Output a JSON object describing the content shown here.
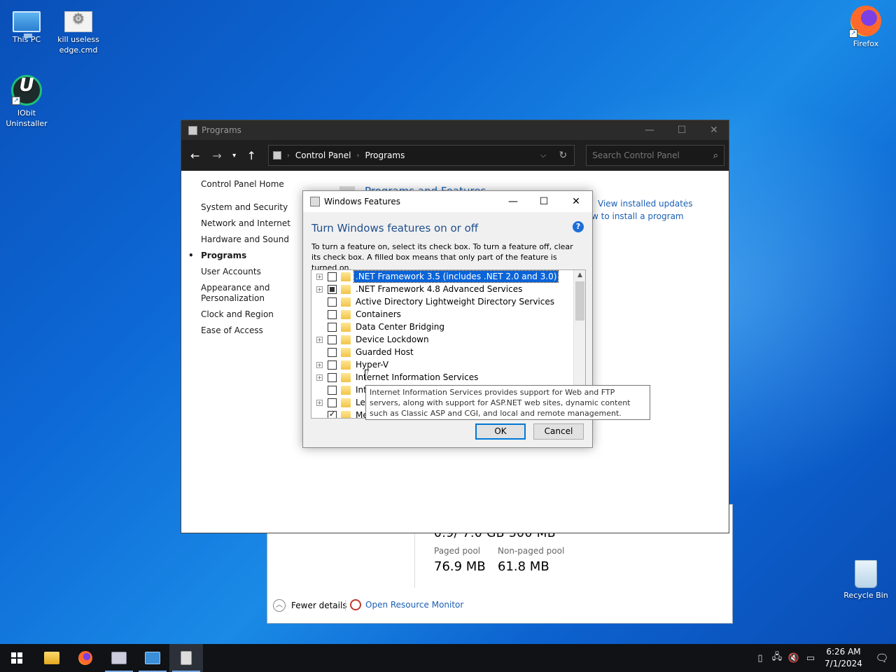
{
  "desktop": {
    "icons": [
      {
        "label": "This PC"
      },
      {
        "label": "kill useless edge.cmd"
      },
      {
        "label": "IObit Uninstaller"
      },
      {
        "label": "Firefox"
      },
      {
        "label": "Recycle Bin"
      }
    ]
  },
  "task_manager": {
    "cut_text": "0.9/ 7.0 GB    300 MB",
    "paged_pool_label": "Paged pool",
    "paged_pool_value": "76.9 MB",
    "nonpaged_pool_label": "Non-paged pool",
    "nonpaged_pool_value": "61.8 MB",
    "fewer_details": "Fewer details",
    "open_resource_monitor": "Open Resource Monitor"
  },
  "control_panel": {
    "title": "Programs",
    "breadcrumb": [
      "Control Panel",
      "Programs"
    ],
    "search_placeholder": "Search Control Panel",
    "sidebar": {
      "home": "Control Panel Home",
      "items": [
        "System and Security",
        "Network and Internet",
        "Hardware and Sound",
        "Programs",
        "User Accounts",
        "Appearance and Personalization",
        "Clock and Region",
        "Ease of Access"
      ],
      "active_index": 3
    },
    "heading": "Programs and Features",
    "link_view_updates": "View installed updates",
    "link_how_install": "w to install a program"
  },
  "windows_features": {
    "title": "Windows Features",
    "heading": "Turn Windows features on or off",
    "help_icon": "?",
    "description": "To turn a feature on, select its check box. To turn a feature off, clear its check box. A filled box means that only part of the feature is turned on.",
    "features": [
      {
        "label": ".NET Framework 3.5 (includes .NET 2.0 and 3.0)",
        "expandable": true,
        "state": "unchecked",
        "selected": true
      },
      {
        "label": ".NET Framework 4.8 Advanced Services",
        "expandable": true,
        "state": "partial",
        "selected": false
      },
      {
        "label": "Active Directory Lightweight Directory Services",
        "expandable": false,
        "state": "unchecked",
        "selected": false
      },
      {
        "label": "Containers",
        "expandable": false,
        "state": "unchecked",
        "selected": false
      },
      {
        "label": "Data Center Bridging",
        "expandable": false,
        "state": "unchecked",
        "selected": false
      },
      {
        "label": "Device Lockdown",
        "expandable": true,
        "state": "unchecked",
        "selected": false
      },
      {
        "label": "Guarded Host",
        "expandable": false,
        "state": "unchecked",
        "selected": false
      },
      {
        "label": "Hyper-V",
        "expandable": true,
        "state": "unchecked",
        "selected": false
      },
      {
        "label": "Internet Information Services",
        "expandable": true,
        "state": "unchecked",
        "selected": false
      },
      {
        "label": "Inter",
        "expandable": false,
        "state": "unchecked",
        "selected": false
      },
      {
        "label": "Lega",
        "expandable": true,
        "state": "unchecked",
        "selected": false
      },
      {
        "label": "Med",
        "expandable": false,
        "state": "checked",
        "selected": false
      }
    ],
    "ok_label": "OK",
    "cancel_label": "Cancel",
    "tooltip": "Internet Information Services provides support for Web and FTP servers, along with support for ASP.NET web sites, dynamic content such as Classic ASP and CGI, and local and remote management."
  },
  "taskbar": {
    "apps": [
      "start",
      "file-explorer",
      "firefox",
      "control-panel-app",
      "windows-features-app",
      "task-manager-app"
    ],
    "time": "6:26 AM",
    "date": "7/1/2024",
    "notification_count": "1"
  },
  "colors": {
    "accent": "#0a64d8",
    "link": "#1a5fb4",
    "heading": "#1e4e8c",
    "titlebar_dark": "#2b2b2b",
    "taskbar": "#101216"
  }
}
